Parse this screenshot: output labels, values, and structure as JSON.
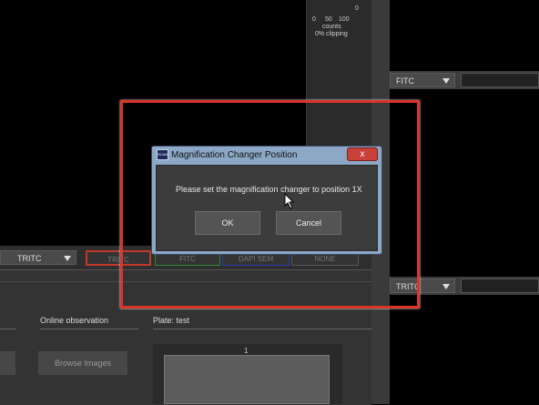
{
  "histogram": {
    "ticks": [
      "0",
      "50",
      "100"
    ],
    "right_value": "0",
    "counts_label": "counts",
    "clipping_label": "0% clipping"
  },
  "right_dropdowns": [
    {
      "value": "FITC"
    },
    {
      "value": "TRITC"
    }
  ],
  "filter_row": {
    "dropdown_value": "TRITC",
    "buttons": [
      {
        "label": "TRITC",
        "color": "#c0392b"
      },
      {
        "label": "FITC",
        "color": "#2e8b3a"
      },
      {
        "label": "DAPI SEM",
        "color": "#2b3fa8"
      },
      {
        "label": "NONE",
        "color": "#555555"
      }
    ]
  },
  "lower_panel": {
    "online_observation_label": "Online observation",
    "plate_label": "Plate: test",
    "browse_images_label": "Browse Images",
    "plate_column_label": "1"
  },
  "dialog": {
    "title": "Magnification Changer Position",
    "icon_text": "SCAN",
    "close_label": "x",
    "message": "Please set the magnification changer to position 1X",
    "ok_label": "OK",
    "cancel_label": "Cancel"
  },
  "colors": {
    "highlight": "#d9352a",
    "titlebar": "#8da8c6",
    "close": "#c9413b"
  }
}
